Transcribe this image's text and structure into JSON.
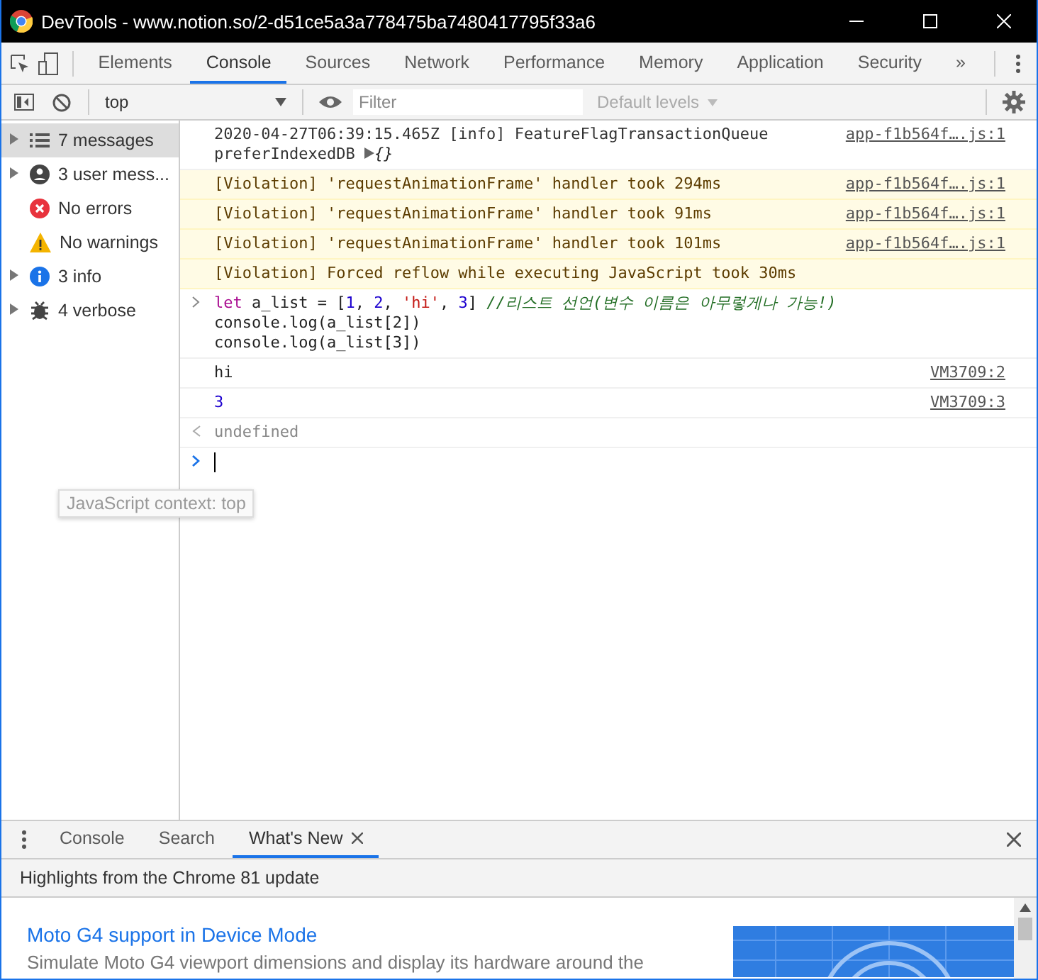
{
  "window": {
    "title": "DevTools - www.notion.so/2-d51ce5a3a778475ba7480417795f33a6"
  },
  "tabs": [
    {
      "label": "Elements",
      "selected": false
    },
    {
      "label": "Console",
      "selected": true
    },
    {
      "label": "Sources",
      "selected": false
    },
    {
      "label": "Network",
      "selected": false
    },
    {
      "label": "Performance",
      "selected": false
    },
    {
      "label": "Memory",
      "selected": false
    },
    {
      "label": "Application",
      "selected": false
    },
    {
      "label": "Security",
      "selected": false
    }
  ],
  "more_tabs": "»",
  "toolbar": {
    "context": "top",
    "filter_placeholder": "Filter",
    "levels": "Default levels"
  },
  "tooltip": "JavaScript context: top",
  "sidebar": [
    {
      "label": "7 messages",
      "kind": "list",
      "expandable": true,
      "selected": true
    },
    {
      "label": "3 user mess...",
      "kind": "user",
      "expandable": true,
      "selected": false
    },
    {
      "label": "No errors",
      "kind": "error",
      "expandable": false,
      "selected": false
    },
    {
      "label": "No warnings",
      "kind": "warning",
      "expandable": false,
      "selected": false
    },
    {
      "label": "3 info",
      "kind": "info",
      "expandable": true,
      "selected": false
    },
    {
      "label": "4 verbose",
      "kind": "verbose",
      "expandable": true,
      "selected": false
    }
  ],
  "messages": [
    {
      "kind": "info",
      "text": "2020-04-27T06:39:15.465Z [info] FeatureFlagTransactionQueue",
      "detail": "preferIndexedDB",
      "preview": "{}",
      "source": "app-f1b564f….js:1"
    },
    {
      "kind": "violation",
      "text": "[Violation] 'requestAnimationFrame' handler took 294ms",
      "source": "app-f1b564f….js:1"
    },
    {
      "kind": "violation",
      "text": "[Violation] 'requestAnimationFrame' handler took 91ms",
      "source": "app-f1b564f….js:1"
    },
    {
      "kind": "violation",
      "text": "[Violation] 'requestAnimationFrame' handler took 101ms",
      "source": "app-f1b564f….js:1"
    },
    {
      "kind": "violation",
      "text": "[Violation] Forced reflow while executing JavaScript took 30ms"
    },
    {
      "kind": "input",
      "lines": [
        [
          {
            "kind": "keyword",
            "text": "let"
          },
          {
            "kind": "plain",
            "text": " a_list = ["
          },
          {
            "kind": "number",
            "text": "1"
          },
          {
            "kind": "plain",
            "text": ", "
          },
          {
            "kind": "number",
            "text": "2"
          },
          {
            "kind": "plain",
            "text": ", "
          },
          {
            "kind": "string",
            "text": "'hi'"
          },
          {
            "kind": "plain",
            "text": ", "
          },
          {
            "kind": "number",
            "text": "3"
          },
          {
            "kind": "plain",
            "text": "] "
          },
          {
            "kind": "comment",
            "text": "//리스트 선언(변수 이름은 아무렇게나 가능!)"
          }
        ],
        [
          {
            "kind": "plain",
            "text": "console.log(a_list[2])"
          }
        ],
        [
          {
            "kind": "plain",
            "text": "console.log(a_list[3])"
          }
        ]
      ]
    },
    {
      "kind": "log",
      "color": "#222222",
      "text": "hi",
      "source": "VM3709:2"
    },
    {
      "kind": "log",
      "color": "#1c00cf",
      "text": "3",
      "source": "VM3709:3"
    },
    {
      "kind": "result",
      "text": "undefined"
    },
    {
      "kind": "prompt"
    }
  ],
  "drawer": {
    "tabs": [
      {
        "label": "Console",
        "selected": false,
        "closable": false
      },
      {
        "label": "Search",
        "selected": false,
        "closable": false
      },
      {
        "label": "What's New",
        "selected": true,
        "closable": true
      }
    ],
    "header": "Highlights from the Chrome 81 update",
    "article": {
      "title": "Moto G4 support in Device Mode",
      "description": "Simulate Moto G4 viewport dimensions and display its hardware around the"
    }
  }
}
